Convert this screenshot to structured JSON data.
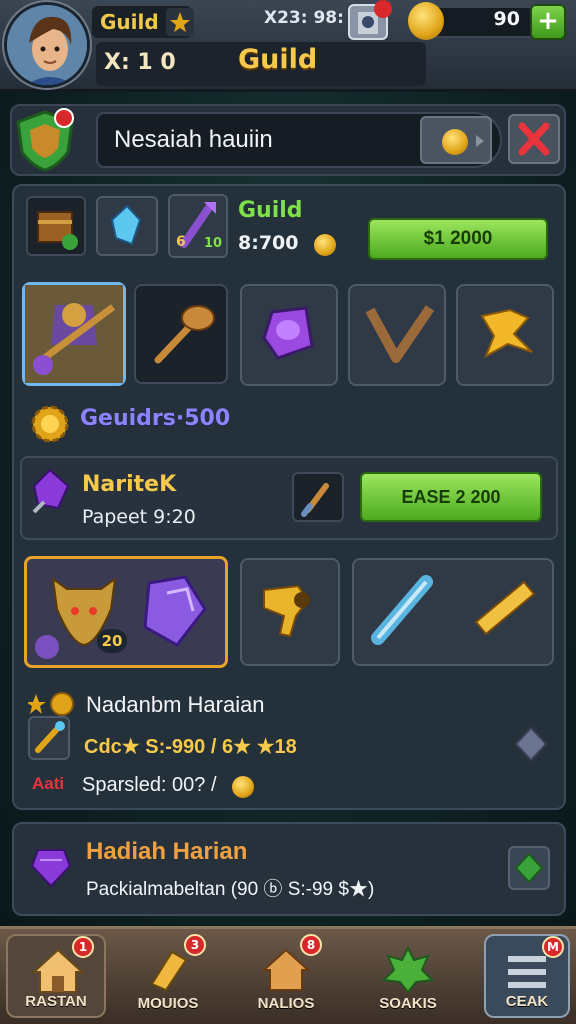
{
  "topbar": {
    "title": "Guild",
    "stat": "X23: 98:",
    "coins": "90",
    "plus": "+",
    "level": "X: 1 0",
    "heading": "Guild"
  },
  "search": {
    "value": "Nesaiah hauiin"
  },
  "offer": {
    "title": "Guild",
    "price": "8:700",
    "button": "$1 2000",
    "item_badge_a": "6",
    "item_badge_b": "10"
  },
  "guild_line": "Geuidrs·500",
  "market": {
    "name": "NaritеK",
    "sub": "Papeet 9:20",
    "button": "EASE 2 200"
  },
  "hero_card": {
    "level": "20"
  },
  "details": {
    "title": "Nadanbm Haraian",
    "line1": "Cdc★ S:-990 / 6★ ★18",
    "line2_prefix": "Aati",
    "line2": "Sparsled: 00? /"
  },
  "daily": {
    "title": "Hadiah Harian",
    "desc": "Packialmabeltan (90 ⓑ S:-99 $★)"
  },
  "nav": {
    "items": [
      {
        "label": "RASTAN",
        "badge": "1"
      },
      {
        "label": "MOUIOS",
        "badge": "3"
      },
      {
        "label": "NALIOS",
        "badge": "8"
      },
      {
        "label": "SOAKIS",
        "badge": ""
      },
      {
        "label": "CEAK",
        "badge": "M"
      }
    ]
  },
  "colors": {
    "accent_gold": "#f6c94a",
    "accent_green": "#7fe04a",
    "badge_red": "#d8282a",
    "guild_line_color": "#8a84ff"
  }
}
